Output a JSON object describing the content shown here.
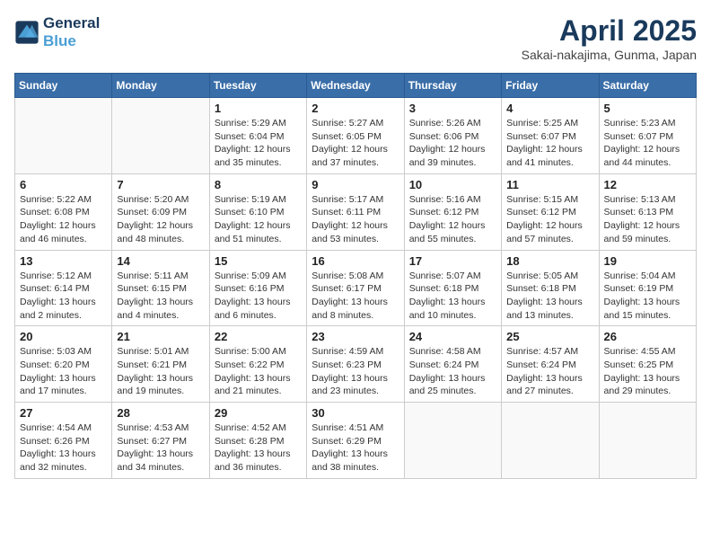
{
  "header": {
    "logo_line1": "General",
    "logo_line2": "Blue",
    "month_title": "April 2025",
    "location": "Sakai-nakajima, Gunma, Japan"
  },
  "weekdays": [
    "Sunday",
    "Monday",
    "Tuesday",
    "Wednesday",
    "Thursday",
    "Friday",
    "Saturday"
  ],
  "weeks": [
    [
      {
        "day": "",
        "content": ""
      },
      {
        "day": "",
        "content": ""
      },
      {
        "day": "1",
        "content": "Sunrise: 5:29 AM\nSunset: 6:04 PM\nDaylight: 12 hours and 35 minutes."
      },
      {
        "day": "2",
        "content": "Sunrise: 5:27 AM\nSunset: 6:05 PM\nDaylight: 12 hours and 37 minutes."
      },
      {
        "day": "3",
        "content": "Sunrise: 5:26 AM\nSunset: 6:06 PM\nDaylight: 12 hours and 39 minutes."
      },
      {
        "day": "4",
        "content": "Sunrise: 5:25 AM\nSunset: 6:07 PM\nDaylight: 12 hours and 41 minutes."
      },
      {
        "day": "5",
        "content": "Sunrise: 5:23 AM\nSunset: 6:07 PM\nDaylight: 12 hours and 44 minutes."
      }
    ],
    [
      {
        "day": "6",
        "content": "Sunrise: 5:22 AM\nSunset: 6:08 PM\nDaylight: 12 hours and 46 minutes."
      },
      {
        "day": "7",
        "content": "Sunrise: 5:20 AM\nSunset: 6:09 PM\nDaylight: 12 hours and 48 minutes."
      },
      {
        "day": "8",
        "content": "Sunrise: 5:19 AM\nSunset: 6:10 PM\nDaylight: 12 hours and 51 minutes."
      },
      {
        "day": "9",
        "content": "Sunrise: 5:17 AM\nSunset: 6:11 PM\nDaylight: 12 hours and 53 minutes."
      },
      {
        "day": "10",
        "content": "Sunrise: 5:16 AM\nSunset: 6:12 PM\nDaylight: 12 hours and 55 minutes."
      },
      {
        "day": "11",
        "content": "Sunrise: 5:15 AM\nSunset: 6:12 PM\nDaylight: 12 hours and 57 minutes."
      },
      {
        "day": "12",
        "content": "Sunrise: 5:13 AM\nSunset: 6:13 PM\nDaylight: 12 hours and 59 minutes."
      }
    ],
    [
      {
        "day": "13",
        "content": "Sunrise: 5:12 AM\nSunset: 6:14 PM\nDaylight: 13 hours and 2 minutes."
      },
      {
        "day": "14",
        "content": "Sunrise: 5:11 AM\nSunset: 6:15 PM\nDaylight: 13 hours and 4 minutes."
      },
      {
        "day": "15",
        "content": "Sunrise: 5:09 AM\nSunset: 6:16 PM\nDaylight: 13 hours and 6 minutes."
      },
      {
        "day": "16",
        "content": "Sunrise: 5:08 AM\nSunset: 6:17 PM\nDaylight: 13 hours and 8 minutes."
      },
      {
        "day": "17",
        "content": "Sunrise: 5:07 AM\nSunset: 6:18 PM\nDaylight: 13 hours and 10 minutes."
      },
      {
        "day": "18",
        "content": "Sunrise: 5:05 AM\nSunset: 6:18 PM\nDaylight: 13 hours and 13 minutes."
      },
      {
        "day": "19",
        "content": "Sunrise: 5:04 AM\nSunset: 6:19 PM\nDaylight: 13 hours and 15 minutes."
      }
    ],
    [
      {
        "day": "20",
        "content": "Sunrise: 5:03 AM\nSunset: 6:20 PM\nDaylight: 13 hours and 17 minutes."
      },
      {
        "day": "21",
        "content": "Sunrise: 5:01 AM\nSunset: 6:21 PM\nDaylight: 13 hours and 19 minutes."
      },
      {
        "day": "22",
        "content": "Sunrise: 5:00 AM\nSunset: 6:22 PM\nDaylight: 13 hours and 21 minutes."
      },
      {
        "day": "23",
        "content": "Sunrise: 4:59 AM\nSunset: 6:23 PM\nDaylight: 13 hours and 23 minutes."
      },
      {
        "day": "24",
        "content": "Sunrise: 4:58 AM\nSunset: 6:24 PM\nDaylight: 13 hours and 25 minutes."
      },
      {
        "day": "25",
        "content": "Sunrise: 4:57 AM\nSunset: 6:24 PM\nDaylight: 13 hours and 27 minutes."
      },
      {
        "day": "26",
        "content": "Sunrise: 4:55 AM\nSunset: 6:25 PM\nDaylight: 13 hours and 29 minutes."
      }
    ],
    [
      {
        "day": "27",
        "content": "Sunrise: 4:54 AM\nSunset: 6:26 PM\nDaylight: 13 hours and 32 minutes."
      },
      {
        "day": "28",
        "content": "Sunrise: 4:53 AM\nSunset: 6:27 PM\nDaylight: 13 hours and 34 minutes."
      },
      {
        "day": "29",
        "content": "Sunrise: 4:52 AM\nSunset: 6:28 PM\nDaylight: 13 hours and 36 minutes."
      },
      {
        "day": "30",
        "content": "Sunrise: 4:51 AM\nSunset: 6:29 PM\nDaylight: 13 hours and 38 minutes."
      },
      {
        "day": "",
        "content": ""
      },
      {
        "day": "",
        "content": ""
      },
      {
        "day": "",
        "content": ""
      }
    ]
  ]
}
